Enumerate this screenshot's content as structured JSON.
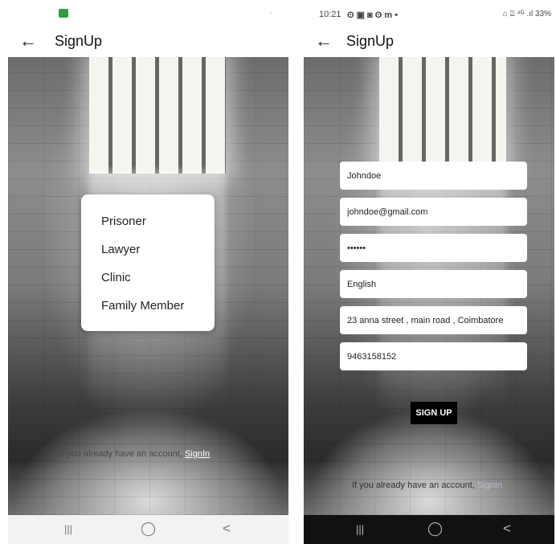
{
  "left_screen": {
    "status_bar": {
      "left_icon": "app-notification-icon",
      "right_text": "·"
    },
    "app_bar": {
      "back_icon": "←",
      "title": "SignUp"
    },
    "role_menu": {
      "items": [
        "Prisoner",
        "Lawyer",
        "Clinic",
        "Family Member"
      ]
    },
    "footer": {
      "prompt": "If you already have an account,",
      "link": "SignIn"
    },
    "nav_bar": {
      "recents": "|||",
      "home": "◯",
      "back": "<"
    }
  },
  "right_screen": {
    "status_bar": {
      "time": "10:21",
      "app_icons": "ʘ ▣ ◙ ʘ m •",
      "right_text": "⌂ ⍍ ⁴ᴳ .ıl 33%"
    },
    "app_bar": {
      "back_icon": "←",
      "title": "SignUp"
    },
    "form": {
      "name": "Johndoe",
      "email": "johndoe@gmail.com",
      "password": "••••••",
      "language": "English",
      "address": "23 anna street , main road , Coimbatore",
      "phone": "9463158152"
    },
    "signup_button": "SIGN UP",
    "footer": {
      "prompt": "If you already have an account,",
      "link": "SignIn"
    },
    "nav_bar": {
      "recents": "|||",
      "home": "◯",
      "back": "<"
    }
  },
  "colors": {
    "background": "#ffffff",
    "left_nav_bar": "#f2f2f2",
    "right_nav_bar": "#111111",
    "signup_button": "#000000",
    "link_right": "#b9b9c9"
  }
}
